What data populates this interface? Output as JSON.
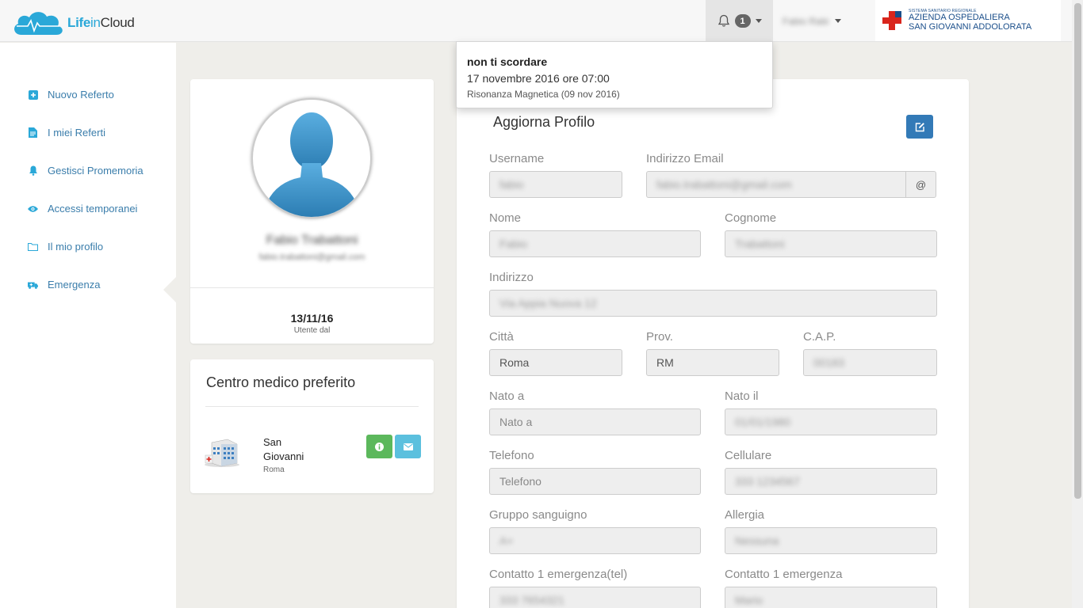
{
  "header": {
    "logo_part1": "Life",
    "logo_part2": "in",
    "logo_part3": "Cloud",
    "notifications_count": "1",
    "user_name": "Fabio Rabi",
    "hospital_small": "SISTEMA SANITARIO REGIONALE",
    "hospital_line1": "AZIENDA OSPEDALIERA",
    "hospital_line2": "SAN GIOVANNI ADDOLORATA"
  },
  "sidebar": {
    "items": [
      {
        "label": "Nuovo Referto",
        "icon": "plus-square-icon"
      },
      {
        "label": "I miei Referti",
        "icon": "file-icon"
      },
      {
        "label": "Gestisci Promemoria",
        "icon": "bell-icon"
      },
      {
        "label": "Accessi temporanei",
        "icon": "eye-icon"
      },
      {
        "label": "Il mio profilo",
        "icon": "folder-icon"
      },
      {
        "label": "Emergenza",
        "icon": "ambulance-icon"
      }
    ]
  },
  "profile": {
    "name": "Fabio Trabattoni",
    "email": "fabio.trabattoni@gmail.com",
    "since_date": "13/11/16",
    "since_label": "Utente dal"
  },
  "medical_center": {
    "title": "Centro medico preferito",
    "name_line1": "San",
    "name_line2": "Giovanni",
    "city": "Roma"
  },
  "notification": {
    "title": "non ti scordare",
    "date": "17 novembre 2016 ore 07:00",
    "subtitle": "Risonanza Magnetica (09 nov 2016)"
  },
  "form": {
    "title": "Aggiorna Profilo",
    "email_addon": "@",
    "fields": {
      "username": {
        "label": "Username",
        "value": "fabio"
      },
      "email": {
        "label": "Indirizzo Email",
        "value": "fabio.trabattoni@gmail.com"
      },
      "nome": {
        "label": "Nome",
        "value": "Fabio"
      },
      "cognome": {
        "label": "Cognome",
        "value": "Trabattoni"
      },
      "indirizzo": {
        "label": "Indirizzo",
        "value": "Via Appia Nuova 12"
      },
      "citta": {
        "label": "Città",
        "value": "Roma"
      },
      "prov": {
        "label": "Prov.",
        "value": "RM"
      },
      "cap": {
        "label": "C.A.P.",
        "value": "00183"
      },
      "nato_a": {
        "label": "Nato a",
        "placeholder": "Nato a"
      },
      "nato_il": {
        "label": "Nato il",
        "value": "01/01/1980"
      },
      "telefono": {
        "label": "Telefono",
        "placeholder": "Telefono"
      },
      "cellulare": {
        "label": "Cellulare",
        "value": "333 1234567"
      },
      "gruppo": {
        "label": "Gruppo sanguigno",
        "value": "A+"
      },
      "allergia": {
        "label": "Allergia",
        "value": "Nessuna"
      },
      "contatto_tel": {
        "label": "Contatto 1 emergenza(tel)",
        "value": "333 7654321"
      },
      "contatto": {
        "label": "Contatto 1 emergenza",
        "value": "Mario"
      }
    }
  },
  "colors": {
    "accent": "#2aa8d8",
    "link": "#3a7dab",
    "edit_button": "#337ab7",
    "info_button": "#5cb85c",
    "mail_button": "#5bc0de"
  }
}
